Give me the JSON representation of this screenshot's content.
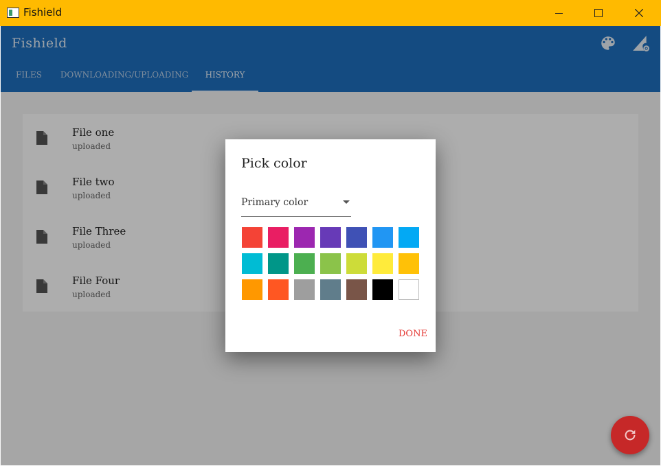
{
  "window": {
    "title": "Fishield",
    "app_icon": "window-app-icon"
  },
  "appbar": {
    "title": "Fishield",
    "actions": [
      {
        "icon": "palette-icon"
      },
      {
        "icon": "network-settings-icon"
      }
    ],
    "accent": "#1E6FBF"
  },
  "tabs": [
    {
      "label": "FILES",
      "active": false
    },
    {
      "label": "DOWNLOADING/UPLOADING",
      "active": false
    },
    {
      "label": "HISTORY",
      "active": true
    }
  ],
  "files": [
    {
      "name": "File one",
      "status": "uploaded",
      "icon": "file-icon"
    },
    {
      "name": "File two",
      "status": "uploaded",
      "icon": "file-icon"
    },
    {
      "name": "File Three",
      "status": "uploaded",
      "icon": "file-icon"
    },
    {
      "name": "File Four",
      "status": "uploaded",
      "icon": "file-icon"
    }
  ],
  "dialog": {
    "title": "Pick color",
    "select_value": "Primary color",
    "done_label": "DONE",
    "colors": [
      [
        "#F44336",
        "#E91E63",
        "#9C27B0",
        "#673AB7",
        "#3F51B5",
        "#2196F3",
        "#03A9F4"
      ],
      [
        "#00BCD4",
        "#009688",
        "#4CAF50",
        "#8BC34A",
        "#CDDC39",
        "#FFEB3B",
        "#FFC107"
      ],
      [
        "#FF9800",
        "#FF5722",
        "#9E9E9E",
        "#607D8B",
        "#795548",
        "#000000",
        "#FFFFFF"
      ]
    ]
  },
  "fab": {
    "icon": "refresh-icon",
    "color": "#C62828"
  }
}
